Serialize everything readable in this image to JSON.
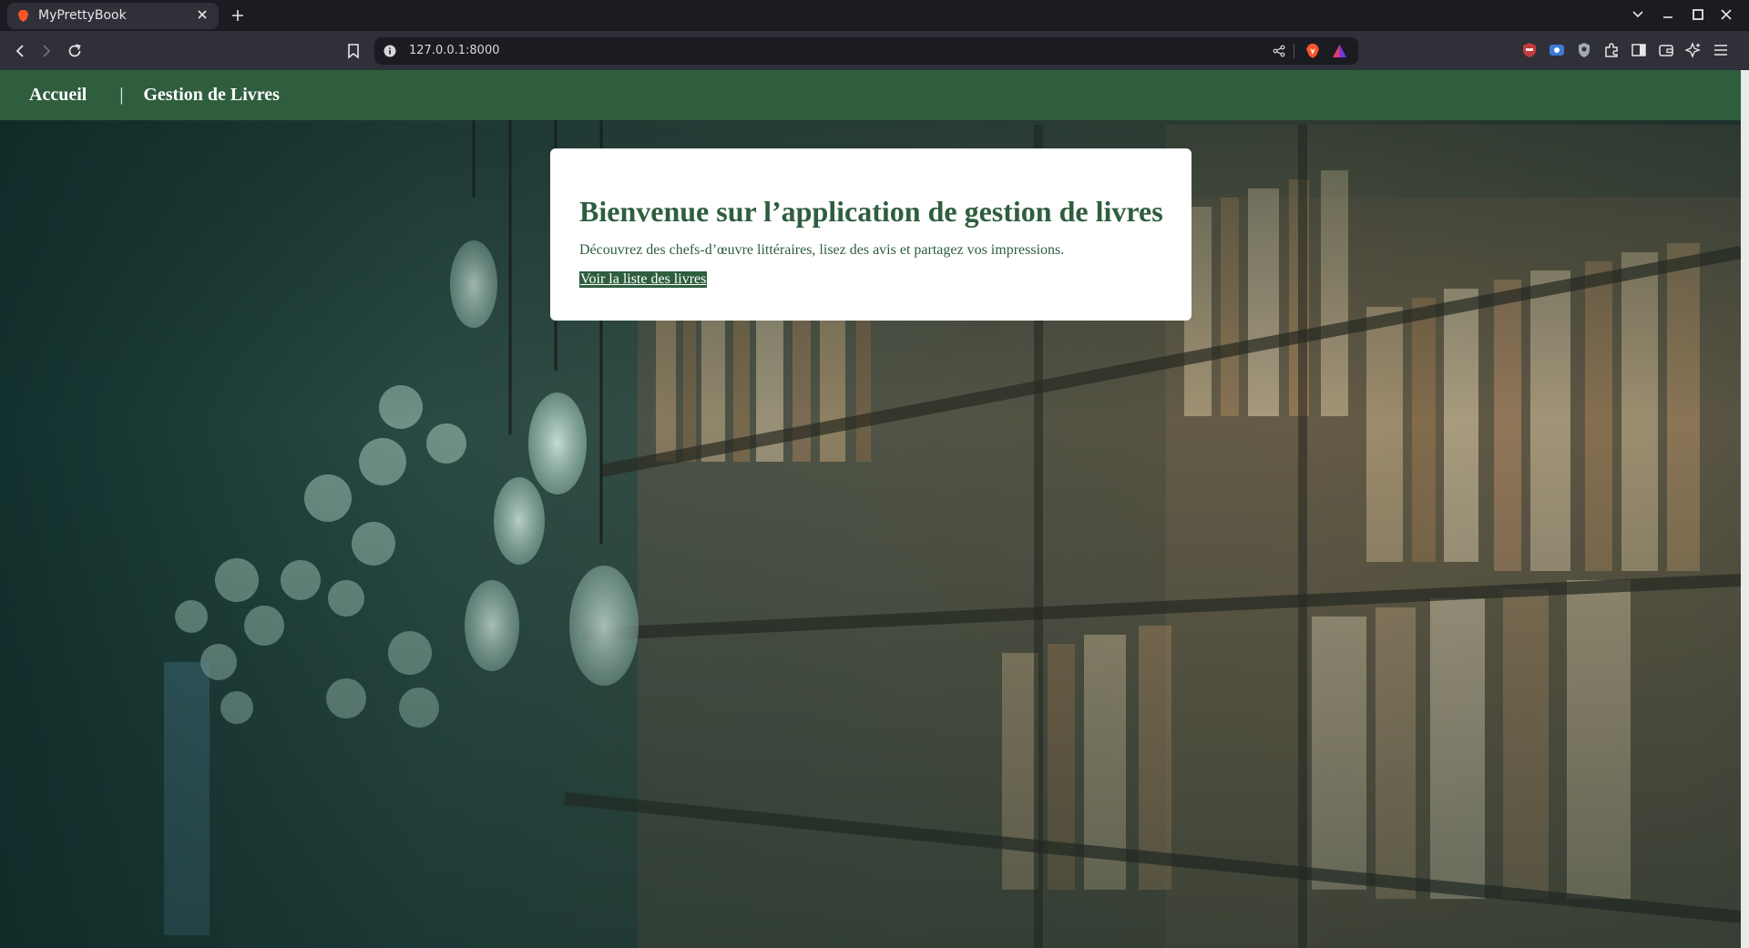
{
  "browser": {
    "tab": {
      "title": "MyPrettyBook"
    },
    "address_bar": {
      "url": "127.0.0.1:8000"
    }
  },
  "site": {
    "nav": {
      "home_label": "Accueil",
      "separator": "|",
      "books_label": "Gestion de Livres"
    },
    "hero": {
      "title": "Bienvenue sur l’application de gestion de livres",
      "subtitle": "Découvrez des chefs-d’œuvre littéraires, lisez des avis et partagez vos impressions.",
      "cta_label": "Voir la liste des livres"
    }
  },
  "colors": {
    "brand_green": "#2e5e3e",
    "card_background": "#ffffff",
    "browser_chrome": "#2f3038"
  },
  "icons": [
    "brave-favicon-icon",
    "close-icon",
    "plus-icon",
    "chevron-down-icon",
    "minimize-icon",
    "maximize-icon",
    "window-close-icon",
    "back-icon",
    "forward-icon",
    "reload-icon",
    "bookmark-icon",
    "info-icon",
    "share-icon",
    "brave-shields-icon",
    "brave-rewards-icon",
    "ublock-icon",
    "screen-capture-icon",
    "privacy-badger-icon",
    "extensions-icon",
    "sidebar-icon",
    "wallet-icon",
    "leo-ai-icon",
    "menu-icon"
  ]
}
